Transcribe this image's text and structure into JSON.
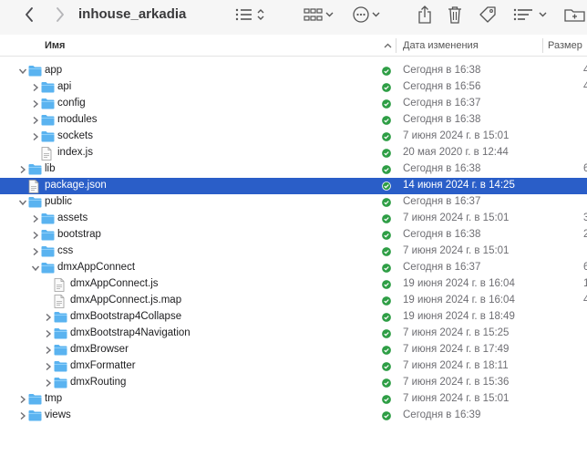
{
  "window": {
    "title": "inhouse_arkadia"
  },
  "toolbar": {
    "back_icon": "chevron-left",
    "forward_icon": "chevron-right",
    "list_view_icon": "list-view",
    "group_icon": "grid-view",
    "more_icon": "ellipsis",
    "share_icon": "share",
    "trash_icon": "trash",
    "tag_icon": "tag",
    "sort_icon": "list-sort",
    "new_folder_icon": "new-folder"
  },
  "columns": {
    "name": "Имя",
    "date": "Дата изменения",
    "size": "Размер"
  },
  "colors": {
    "folder": "#5ab3f0",
    "selection": "#2a5ec8",
    "status": "#2e9e45"
  },
  "rows": [
    {
      "name": "app",
      "date": "Сегодня в 16:38",
      "size": "4",
      "type": "folder",
      "level": 0,
      "expanded": true,
      "selected": false
    },
    {
      "name": "api",
      "date": "Сегодня в 16:56",
      "size": "4",
      "type": "folder",
      "level": 1,
      "expanded": false,
      "selected": false
    },
    {
      "name": "config",
      "date": "Сегодня в 16:37",
      "size": "",
      "type": "folder",
      "level": 1,
      "expanded": false,
      "selected": false
    },
    {
      "name": "modules",
      "date": "Сегодня в 16:38",
      "size": "",
      "type": "folder",
      "level": 1,
      "expanded": false,
      "selected": false
    },
    {
      "name": "sockets",
      "date": "7 июня 2024 г. в 15:01",
      "size": "",
      "type": "folder",
      "level": 1,
      "expanded": false,
      "selected": false
    },
    {
      "name": "index.js",
      "date": "20 мая 2020 г. в 12:44",
      "size": "",
      "type": "file",
      "level": 1,
      "expanded": false,
      "selected": false
    },
    {
      "name": "lib",
      "date": "Сегодня в 16:38",
      "size": "6",
      "type": "folder",
      "level": 0,
      "expanded": false,
      "selected": false
    },
    {
      "name": "package.json",
      "date": "14 июня 2024 г. в 14:25",
      "size": "",
      "type": "file",
      "level": 0,
      "expanded": false,
      "selected": true
    },
    {
      "name": "public",
      "date": "Сегодня в 16:37",
      "size": "",
      "type": "folder",
      "level": 0,
      "expanded": true,
      "selected": false
    },
    {
      "name": "assets",
      "date": "7 июня 2024 г. в 15:01",
      "size": "3",
      "type": "folder",
      "level": 1,
      "expanded": false,
      "selected": false
    },
    {
      "name": "bootstrap",
      "date": "Сегодня в 16:38",
      "size": "2",
      "type": "folder",
      "level": 1,
      "expanded": false,
      "selected": false
    },
    {
      "name": "css",
      "date": "7 июня 2024 г. в 15:01",
      "size": "",
      "type": "folder",
      "level": 1,
      "expanded": false,
      "selected": false
    },
    {
      "name": "dmxAppConnect",
      "date": "Сегодня в 16:37",
      "size": "6",
      "type": "folder",
      "level": 1,
      "expanded": true,
      "selected": false
    },
    {
      "name": "dmxAppConnect.js",
      "date": "19 июня 2024 г. в 16:04",
      "size": "1",
      "type": "file",
      "level": 2,
      "expanded": false,
      "selected": false
    },
    {
      "name": "dmxAppConnect.js.map",
      "date": "19 июня 2024 г. в 16:04",
      "size": "4",
      "type": "file",
      "level": 2,
      "expanded": false,
      "selected": false
    },
    {
      "name": "dmxBootstrap4Collapse",
      "date": "19 июня 2024 г. в 18:49",
      "size": "",
      "type": "folder",
      "level": 2,
      "expanded": false,
      "selected": false
    },
    {
      "name": "dmxBootstrap4Navigation",
      "date": "7 июня 2024 г. в 15:25",
      "size": "",
      "type": "folder",
      "level": 2,
      "expanded": false,
      "selected": false
    },
    {
      "name": "dmxBrowser",
      "date": "7 июня 2024 г. в 17:49",
      "size": "",
      "type": "folder",
      "level": 2,
      "expanded": false,
      "selected": false
    },
    {
      "name": "dmxFormatter",
      "date": "7 июня 2024 г. в 18:11",
      "size": "",
      "type": "folder",
      "level": 2,
      "expanded": false,
      "selected": false
    },
    {
      "name": "dmxRouting",
      "date": "7 июня 2024 г. в 15:36",
      "size": "",
      "type": "folder",
      "level": 2,
      "expanded": false,
      "selected": false
    },
    {
      "name": "tmp",
      "date": "7 июня 2024 г. в 15:01",
      "size": "",
      "type": "folder",
      "level": 0,
      "expanded": false,
      "selected": false
    },
    {
      "name": "views",
      "date": "Сегодня в 16:39",
      "size": "",
      "type": "folder",
      "level": 0,
      "expanded": false,
      "selected": false
    }
  ]
}
